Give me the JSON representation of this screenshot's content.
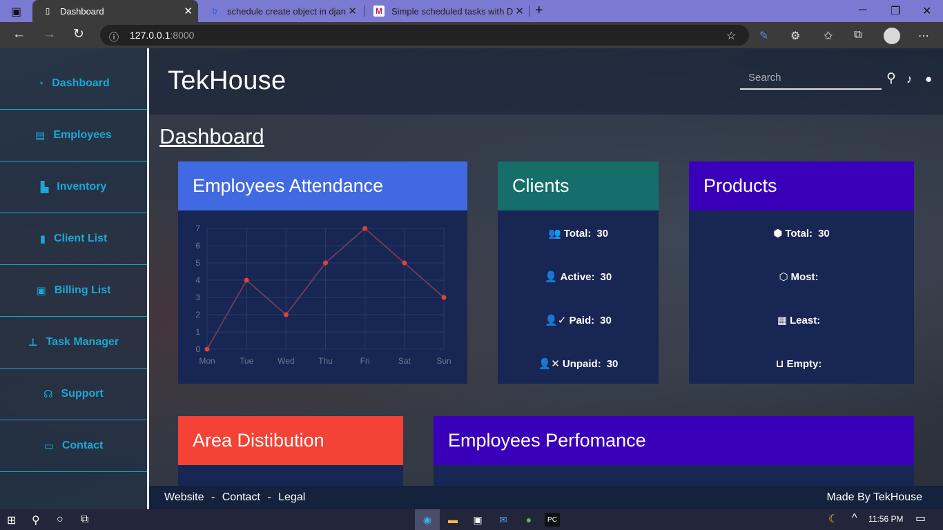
{
  "browser": {
    "tabs": [
      {
        "title": "Dashboard",
        "active": true
      },
      {
        "title": "schedule create object in django",
        "active": false
      },
      {
        "title": "Simple scheduled tasks with Djar",
        "active": false
      }
    ],
    "url_host": "127.0.0.1",
    "url_port": ":8000"
  },
  "sidebar": {
    "items": [
      {
        "label": "Dashboard",
        "icon": "gauge-icon"
      },
      {
        "label": "Employees",
        "icon": "id-card-icon"
      },
      {
        "label": "Inventory",
        "icon": "dolly-icon"
      },
      {
        "label": "Client List",
        "icon": "address-book-icon"
      },
      {
        "label": "Billing List",
        "icon": "money-bill-icon"
      },
      {
        "label": "Task Manager",
        "icon": "thumbtack-icon"
      },
      {
        "label": "Support",
        "icon": "headset-icon"
      },
      {
        "label": "Contact",
        "icon": "chalkboard-user-icon"
      }
    ]
  },
  "header": {
    "brand": "TekHouse",
    "search_placeholder": "Search"
  },
  "main": {
    "title": "Dashboard",
    "attendance": {
      "title": "Employees Attendance",
      "color": "#4169e1"
    },
    "clients": {
      "title": "Clients",
      "color": "#156e6a",
      "rows": [
        {
          "label": "Total:",
          "value": "30",
          "icon": "users-icon"
        },
        {
          "label": "Active:",
          "value": "30",
          "icon": "user-icon"
        },
        {
          "label": "Paid:",
          "value": "30",
          "icon": "user-check-icon"
        },
        {
          "label": "Unpaid:",
          "value": "30",
          "icon": "user-xmark-icon"
        }
      ]
    },
    "products": {
      "title": "Products",
      "color": "#3a00b9",
      "rows": [
        {
          "label": "Total:",
          "value": "30",
          "icon": "cubes-icon"
        },
        {
          "label": "Most:",
          "value": "",
          "icon": "cube-icon"
        },
        {
          "label": "Least:",
          "value": "",
          "icon": "box-icon"
        },
        {
          "label": "Empty:",
          "value": "",
          "icon": "box-open-icon"
        }
      ]
    },
    "area": {
      "title": "Area Distibution",
      "color": "#f44336"
    },
    "performance": {
      "title": "Employees Perfomance",
      "color": "#3a00b9"
    }
  },
  "footer": {
    "links": [
      "Website",
      "Contact",
      "Legal"
    ],
    "separator": "-",
    "credit": "Made By TekHouse"
  },
  "taskbar": {
    "time": "11:56 PM"
  },
  "chart_data": {
    "type": "line",
    "categories": [
      "Mon",
      "Tue",
      "Wed",
      "Thu",
      "Fri",
      "Sat",
      "Sun"
    ],
    "values": [
      0,
      4,
      2,
      5,
      7,
      5,
      3
    ],
    "ylim": [
      0,
      7
    ],
    "yticks": [
      0,
      1,
      2,
      3,
      4,
      5,
      6,
      7
    ],
    "grid": true,
    "line_color": "#6b3b5a",
    "point_color": "#e0413a"
  }
}
